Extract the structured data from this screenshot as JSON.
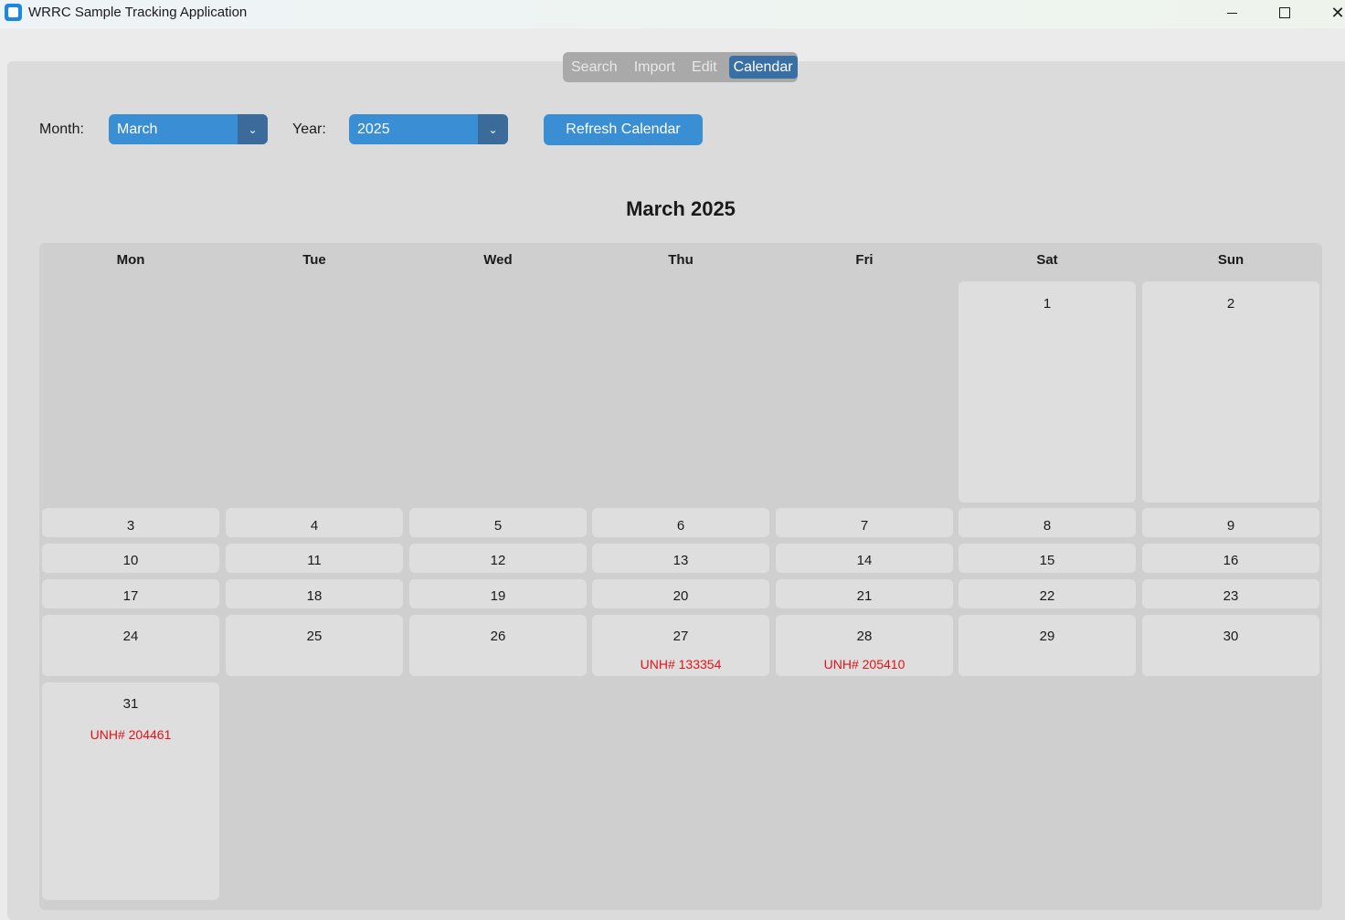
{
  "window": {
    "title": "WRRC Sample Tracking Application",
    "minimize_icon": "minimize-icon",
    "maximize_icon": "maximize-icon",
    "close_icon": "close-icon",
    "close_glyph": "✕"
  },
  "tabs": [
    {
      "label": "Search",
      "active": false
    },
    {
      "label": "Import",
      "active": false
    },
    {
      "label": "Edit",
      "active": false
    },
    {
      "label": "Calendar",
      "active": true
    }
  ],
  "controls": {
    "month_label": "Month:",
    "month_value": "March",
    "year_label": "Year:",
    "year_value": "2025",
    "dropdown_glyph": "⌄",
    "refresh_label": "Refresh Calendar"
  },
  "calendar": {
    "title": "March 2025",
    "weekdays": [
      "Mon",
      "Tue",
      "Wed",
      "Thu",
      "Fri",
      "Sat",
      "Sun"
    ],
    "days": {
      "1": "1",
      "2": "2",
      "3": "3",
      "4": "4",
      "5": "5",
      "6": "6",
      "7": "7",
      "8": "8",
      "9": "9",
      "10": "10",
      "11": "11",
      "12": "12",
      "13": "13",
      "14": "14",
      "15": "15",
      "16": "16",
      "17": "17",
      "18": "18",
      "19": "19",
      "20": "20",
      "21": "21",
      "22": "22",
      "23": "23",
      "24": "24",
      "25": "25",
      "26": "26",
      "27": "27",
      "28": "28",
      "29": "29",
      "30": "30",
      "31": "31"
    },
    "events": {
      "27": "UNH# 133354",
      "28": "UNH# 205410",
      "31": "UNH# 204461"
    }
  },
  "colors": {
    "accent": "#3a8ed3",
    "active_tab": "#3a6fa4",
    "event_text": "#e0131a"
  }
}
